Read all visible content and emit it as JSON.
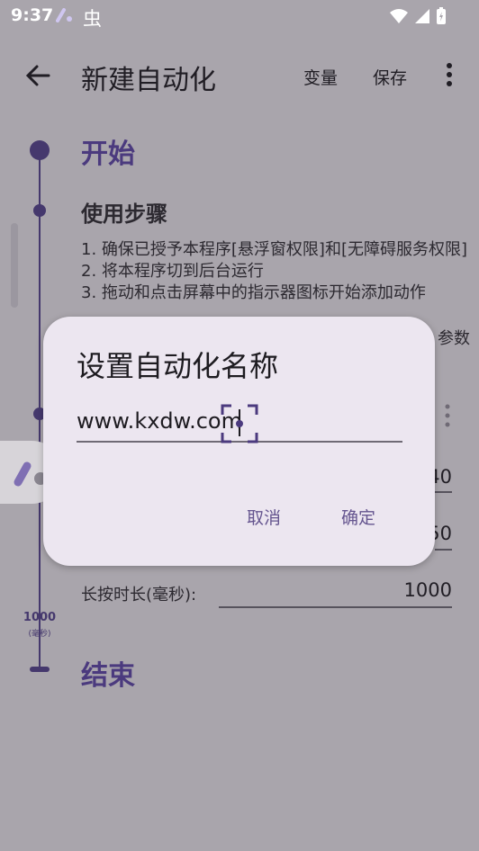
{
  "status_bar": {
    "time": "9:37",
    "app_icon": "automation-app-icon",
    "bug_icon": "虫"
  },
  "app_bar": {
    "title": "新建自动化",
    "variables_label": "变量",
    "save_label": "保存"
  },
  "timeline": {
    "start_title": "开始",
    "steps_title": "使用步骤",
    "steps_text": "1. 确保已授予本程序[悬浮窗权限]和[无障碍服务权限]\n2. 将本程序切到后台运行\n3. 拖动和点击屏幕中的指示器图标开始添加动作",
    "steps_text_trailing": "参数",
    "node_duration_value": "1000",
    "node_duration_unit": "(毫秒)",
    "end_title": "结束"
  },
  "action_card": {
    "field1_value_visible": "40",
    "field2_value_visible": "50",
    "long_press_label": "长按时长(毫秒):",
    "long_press_value": "1000"
  },
  "dialog": {
    "title": "设置自动化名称",
    "input_value": "www.kxdw.com",
    "cancel_label": "取消",
    "confirm_label": "确定"
  },
  "colors": {
    "accent": "#4b3a7e",
    "dialog_bg": "#ece6f0",
    "dialog_button": "#65558f",
    "scrim": "#a9a5ac"
  }
}
